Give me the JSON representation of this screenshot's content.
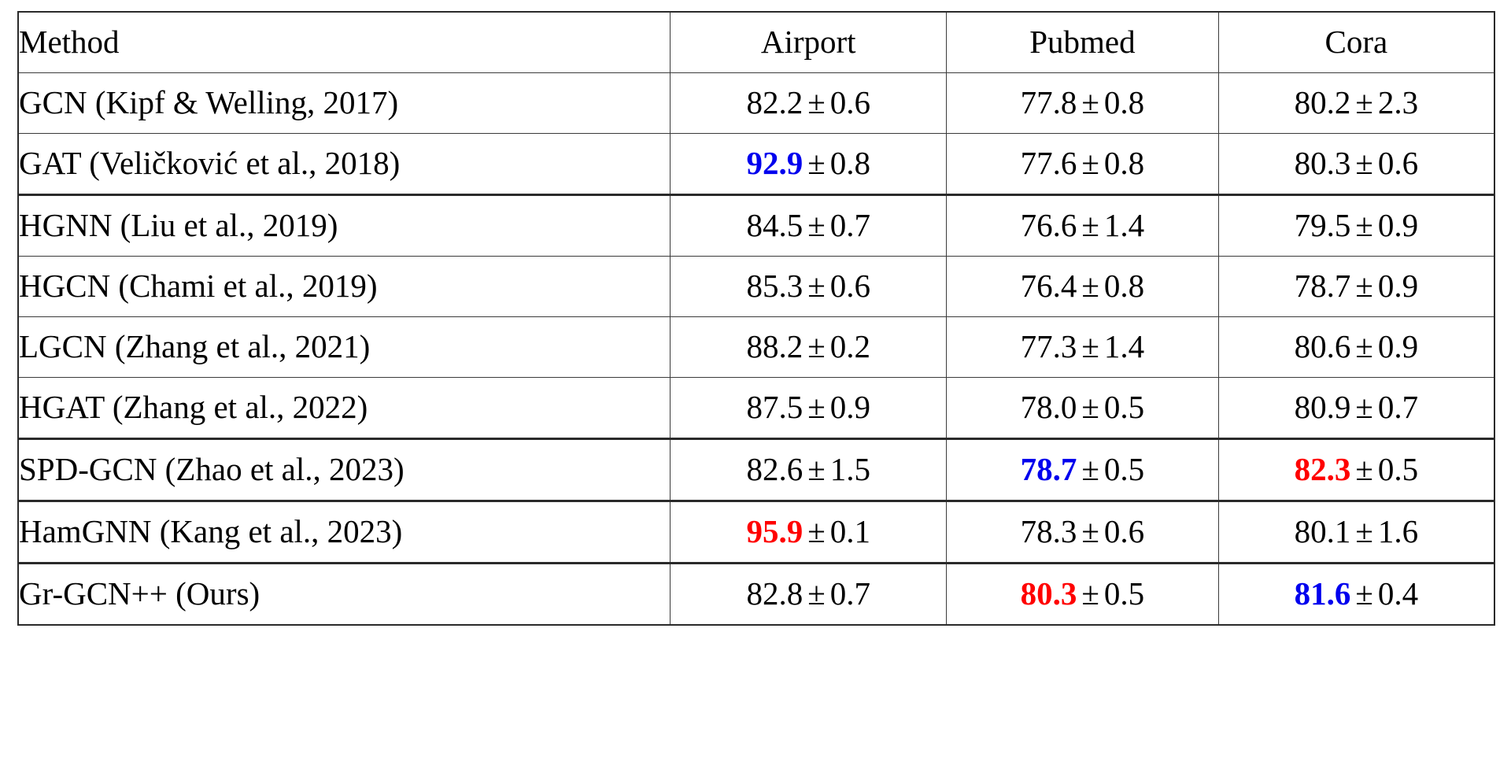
{
  "table": {
    "columns": [
      {
        "key": "method",
        "label": "Method",
        "align": "left"
      },
      {
        "key": "airport",
        "label": "Airport",
        "align": "center"
      },
      {
        "key": "pubmed",
        "label": "Pubmed",
        "align": "center"
      },
      {
        "key": "cora",
        "label": "Cora",
        "align": "center"
      }
    ],
    "plus_minus": "±",
    "highlight_colors": {
      "best": "#ff0000",
      "second_best": "#0000ee",
      "normal": "#000000"
    },
    "groups": [
      {
        "name": "euclidean-gnns",
        "rows": [
          {
            "method": "GCN (Kipf & Welling, 2017)",
            "airport": {
              "value": "82.2",
              "std": "0.6",
              "style": "normal"
            },
            "pubmed": {
              "value": "77.8",
              "std": "0.8",
              "style": "normal"
            },
            "cora": {
              "value": "80.2",
              "std": "2.3",
              "style": "normal"
            }
          },
          {
            "method": "GAT (Veličković et al., 2018)",
            "airport": {
              "value": "92.9",
              "std": "0.8",
              "style": "second_best"
            },
            "pubmed": {
              "value": "77.6",
              "std": "0.8",
              "style": "normal"
            },
            "cora": {
              "value": "80.3",
              "std": "0.6",
              "style": "normal"
            }
          }
        ]
      },
      {
        "name": "hyperbolic-gnns",
        "rows": [
          {
            "method": "HGNN (Liu et al., 2019)",
            "airport": {
              "value": "84.5",
              "std": "0.7",
              "style": "normal"
            },
            "pubmed": {
              "value": "76.6",
              "std": "1.4",
              "style": "normal"
            },
            "cora": {
              "value": "79.5",
              "std": "0.9",
              "style": "normal"
            }
          },
          {
            "method": "HGCN (Chami et al., 2019)",
            "airport": {
              "value": "85.3",
              "std": "0.6",
              "style": "normal"
            },
            "pubmed": {
              "value": "76.4",
              "std": "0.8",
              "style": "normal"
            },
            "cora": {
              "value": "78.7",
              "std": "0.9",
              "style": "normal"
            }
          },
          {
            "method": "LGCN (Zhang et al., 2021)",
            "airport": {
              "value": "88.2",
              "std": "0.2",
              "style": "normal"
            },
            "pubmed": {
              "value": "77.3",
              "std": "1.4",
              "style": "normal"
            },
            "cora": {
              "value": "80.6",
              "std": "0.9",
              "style": "normal"
            }
          },
          {
            "method": "HGAT (Zhang et al., 2022)",
            "airport": {
              "value": "87.5",
              "std": "0.9",
              "style": "normal"
            },
            "pubmed": {
              "value": "78.0",
              "std": "0.5",
              "style": "normal"
            },
            "cora": {
              "value": "80.9",
              "std": "0.7",
              "style": "normal"
            }
          }
        ]
      },
      {
        "name": "spd-gcn",
        "rows": [
          {
            "method": "SPD-GCN (Zhao et al., 2023)",
            "airport": {
              "value": "82.6",
              "std": "1.5",
              "style": "normal"
            },
            "pubmed": {
              "value": "78.7",
              "std": "0.5",
              "style": "second_best"
            },
            "cora": {
              "value": "82.3",
              "std": "0.5",
              "style": "best"
            }
          }
        ]
      },
      {
        "name": "hamgnn",
        "rows": [
          {
            "method": "HamGNN (Kang et al., 2023)",
            "airport": {
              "value": "95.9",
              "std": "0.1",
              "style": "best"
            },
            "pubmed": {
              "value": "78.3",
              "std": "0.6",
              "style": "normal"
            },
            "cora": {
              "value": "80.1",
              "std": "1.6",
              "style": "normal"
            }
          }
        ]
      },
      {
        "name": "ours",
        "rows": [
          {
            "method": "Gr-GCN++ (Ours)",
            "airport": {
              "value": "82.8",
              "std": "0.7",
              "style": "normal"
            },
            "pubmed": {
              "value": "80.3",
              "std": "0.5",
              "style": "best"
            },
            "cora": {
              "value": "81.6",
              "std": "0.4",
              "style": "second_best"
            }
          }
        ]
      }
    ]
  }
}
